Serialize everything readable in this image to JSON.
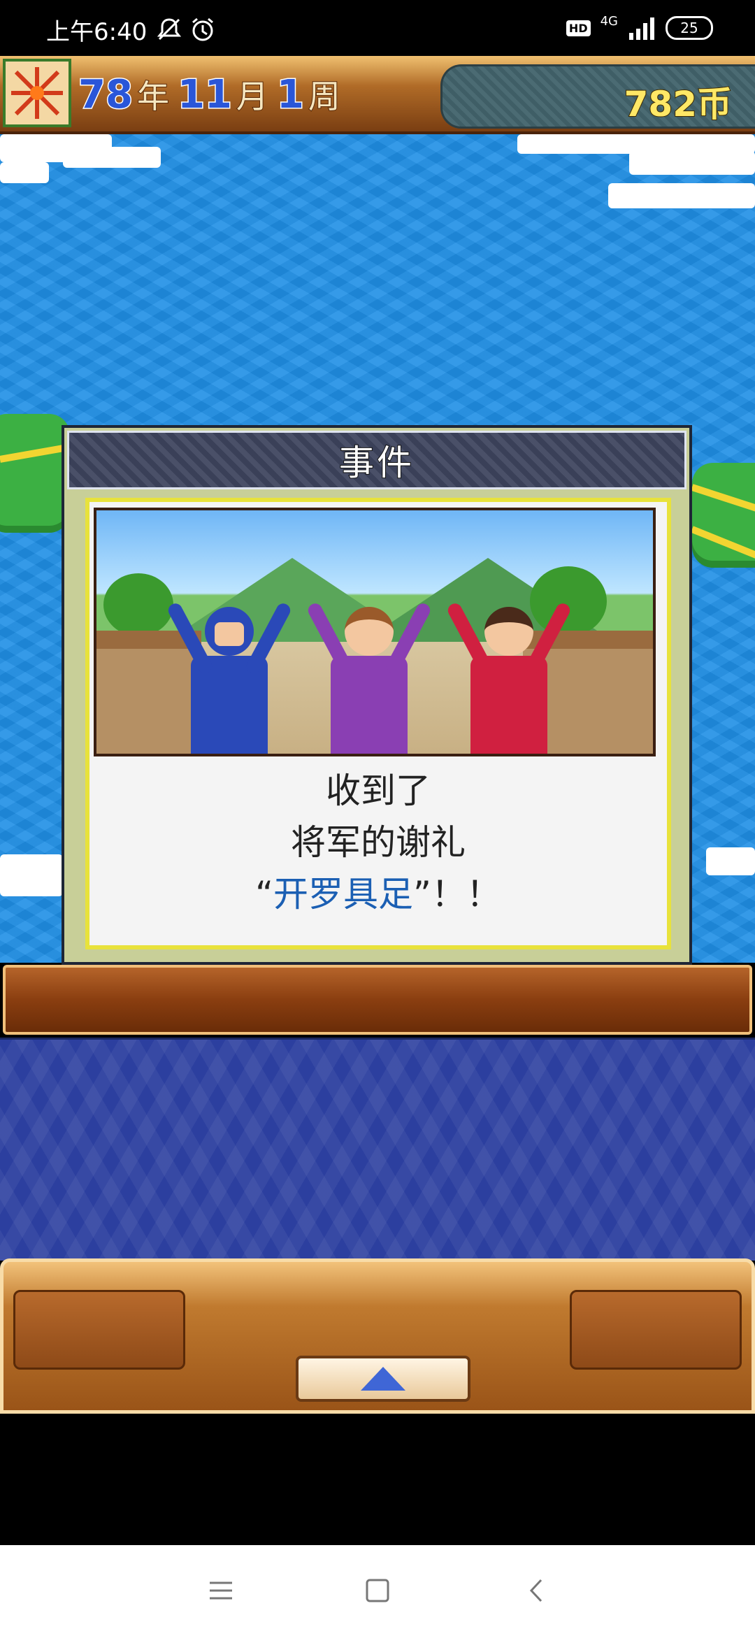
{
  "status_bar": {
    "time": "上午6:40",
    "hd_label": "HD",
    "network_label": "4G",
    "battery_level": "25",
    "icons": [
      "mute-icon",
      "alarm-icon",
      "signal-icon",
      "battery-icon"
    ]
  },
  "header": {
    "year_num": "78",
    "year_unit": "年",
    "month_num": "11",
    "month_unit": "月",
    "week_num": "1",
    "week_unit": "周",
    "coins": "782币"
  },
  "dialog": {
    "title": "事件",
    "line1": "收到了",
    "line2": "将军的谢礼",
    "quote_open": "“",
    "item": "开罗具足",
    "quote_close": "”！！"
  },
  "colors": {
    "sea": "#1f8fe6",
    "dialog_frame": "#c8cf98",
    "item_text": "#1b5fb3",
    "pattern": "#2c3f9f"
  },
  "nav": {
    "icons": [
      "menu-icon",
      "home-icon",
      "back-icon"
    ]
  }
}
